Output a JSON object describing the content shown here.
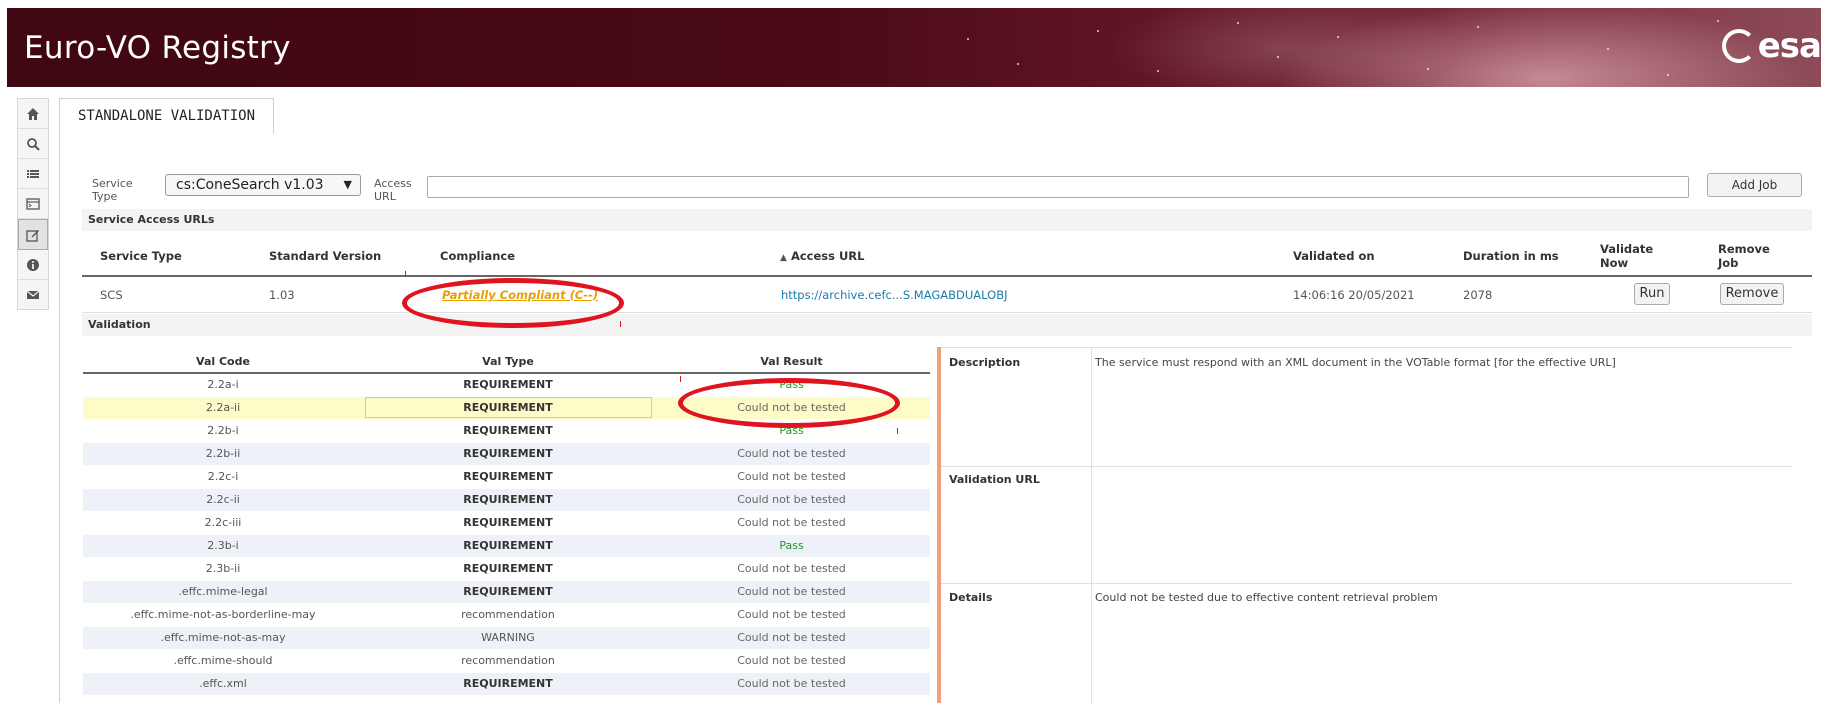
{
  "header": {
    "title": "Euro-VO Registry",
    "logo_text": "esa"
  },
  "toolbar": {
    "items": [
      "home-icon",
      "search-icon",
      "list-icon",
      "terminal-icon",
      "edit-icon",
      "info-icon",
      "mail-icon"
    ]
  },
  "tab": {
    "label": "STANDALONE VALIDATION"
  },
  "form": {
    "service_type_label": "Service Type",
    "service_type_value": "cs:ConeSearch v1.03",
    "access_url_label": "Access URL",
    "access_url_value": "",
    "add_job_label": "Add Job"
  },
  "service_urls": {
    "section_title": "Service Access URLs",
    "headers": {
      "service_type": "Service Type",
      "standard_version": "Standard Version",
      "compliance": "Compliance",
      "access_url": "Access URL",
      "sort_indicator": "▲",
      "validated_on": "Validated on",
      "duration": "Duration in ms",
      "validate_now": "Validate Now",
      "remove_job": "Remove Job"
    },
    "row": {
      "service_type": "SCS",
      "standard_version": "1.03",
      "compliance": "Partially Compliant (C--)",
      "access_url": "https://archive.cefc...S.MAGABDUALOBJ",
      "validated_on": "14:06:16 20/05/2021",
      "duration": "2078",
      "run_label": "Run",
      "remove_label": "Remove"
    }
  },
  "validation": {
    "section_title": "Validation",
    "headers": {
      "code": "Val Code",
      "type": "Val Type",
      "result": "Val Result"
    },
    "rows": [
      {
        "code": "2.2a-i",
        "type": "REQUIREMENT",
        "result": "Pass"
      },
      {
        "code": "2.2a-ii",
        "type": "REQUIREMENT",
        "result": "Could not be tested"
      },
      {
        "code": "2.2b-i",
        "type": "REQUIREMENT",
        "result": "Pass"
      },
      {
        "code": "2.2b-ii",
        "type": "REQUIREMENT",
        "result": "Could not be tested"
      },
      {
        "code": "2.2c-i",
        "type": "REQUIREMENT",
        "result": "Could not be tested"
      },
      {
        "code": "2.2c-ii",
        "type": "REQUIREMENT",
        "result": "Could not be tested"
      },
      {
        "code": "2.2c-iii",
        "type": "REQUIREMENT",
        "result": "Could not be tested"
      },
      {
        "code": "2.3b-i",
        "type": "REQUIREMENT",
        "result": "Pass"
      },
      {
        "code": "2.3b-ii",
        "type": "REQUIREMENT",
        "result": "Could not be tested"
      },
      {
        "code": ".effc.mime-legal",
        "type": "REQUIREMENT",
        "result": "Could not be tested"
      },
      {
        "code": ".effc.mime-not-as-borderline-may",
        "type": "recommendation",
        "result": "Could not be tested"
      },
      {
        "code": ".effc.mime-not-as-may",
        "type": "WARNING",
        "result": "Could not be tested"
      },
      {
        "code": ".effc.mime-should",
        "type": "recommendation",
        "result": "Could not be tested"
      },
      {
        "code": ".effc.xml",
        "type": "REQUIREMENT",
        "result": "Could not be tested"
      }
    ]
  },
  "detail": {
    "description_label": "Description",
    "description_text": "The service must respond with an XML document in the VOTable format [for the effective URL]",
    "validation_url_label": "Validation URL",
    "validation_url_text": "",
    "details_label": "Details",
    "details_text": "Could not be tested due to effective content retrieval problem"
  },
  "colors": {
    "banner": "#4a0a16",
    "annotation_red": "#e0141e",
    "pass_green": "#1f9a1f",
    "compliance_orange": "#e8a000",
    "link_blue": "#1a7ca8",
    "highlight_row": "#fdfcc8"
  }
}
